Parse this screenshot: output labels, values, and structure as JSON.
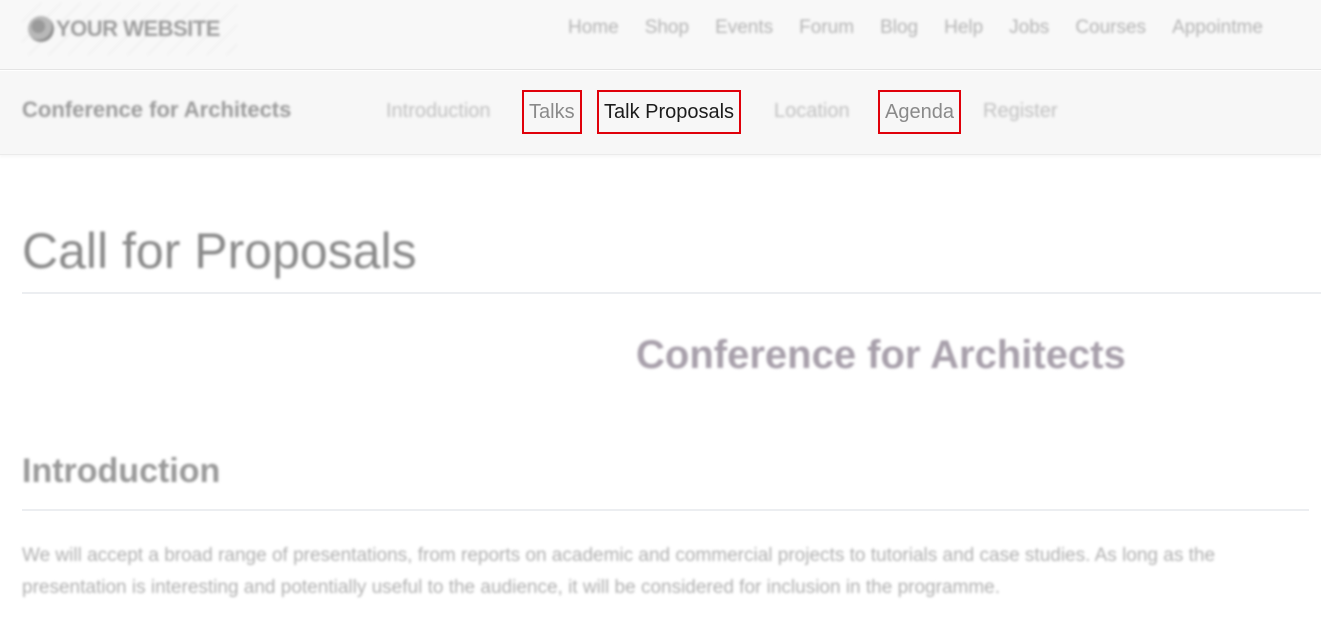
{
  "header": {
    "logo_text": "YOUR WEBSITE",
    "logo_icon": "globe-icon",
    "nav": [
      {
        "label": "Home"
      },
      {
        "label": "Shop"
      },
      {
        "label": "Events"
      },
      {
        "label": "Forum"
      },
      {
        "label": "Blog"
      },
      {
        "label": "Help"
      },
      {
        "label": "Jobs"
      },
      {
        "label": "Courses"
      },
      {
        "label": "Appointme"
      }
    ]
  },
  "event_nav": {
    "title": "Conference for Architects",
    "items": [
      {
        "label": "Introduction"
      },
      {
        "label": "Talks",
        "highlighted": true
      },
      {
        "label": "Talk Proposals",
        "highlighted": true,
        "active": true
      },
      {
        "label": "Location"
      },
      {
        "label": "Agenda",
        "highlighted": true
      },
      {
        "label": "Register"
      }
    ],
    "highlight_color": "#e0000a"
  },
  "content": {
    "page_title": "Call for Proposals",
    "event_heading": "Conference for Architects",
    "section_title": "Introduction",
    "intro_text": "We will accept a broad range of presentations, from reports on academic and commercial projects to tutorials and case studies. As long as the presentation is interesting and potentially useful to the audience, it will be considered for inclusion in the programme."
  }
}
